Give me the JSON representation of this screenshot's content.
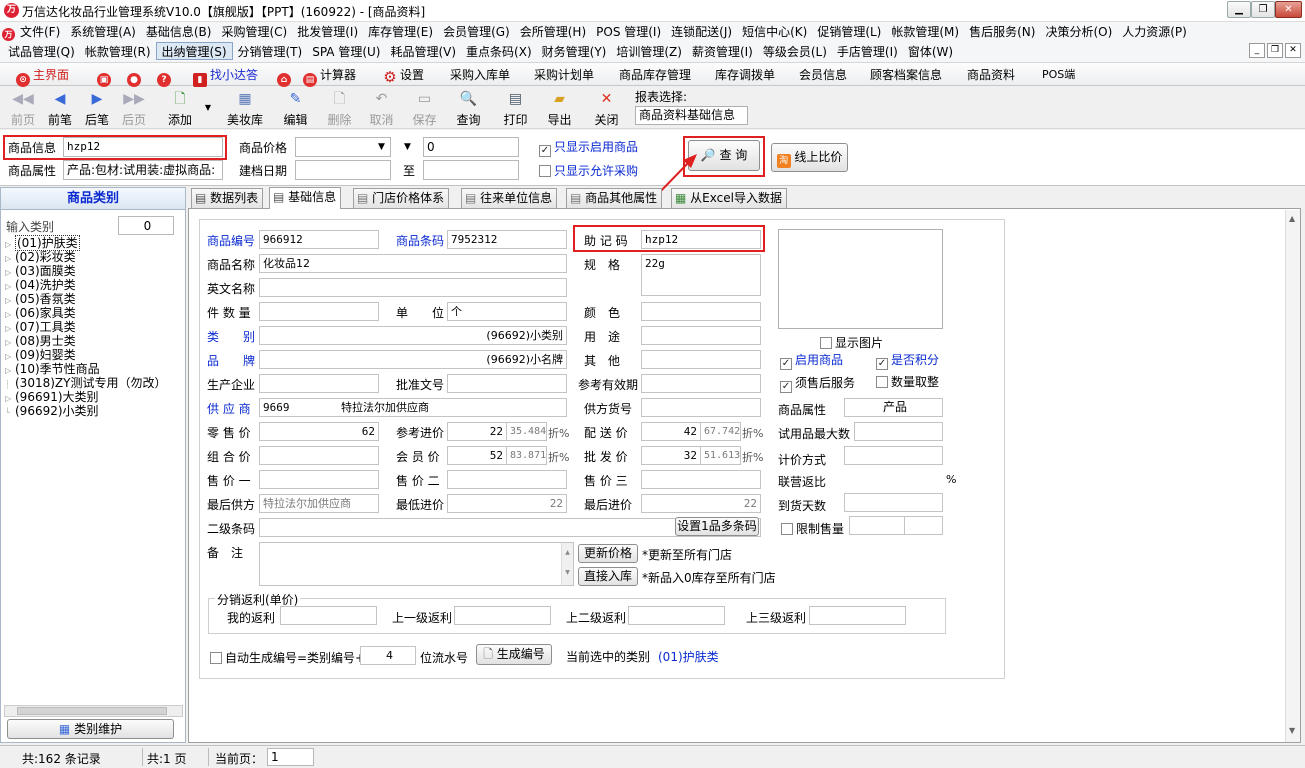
{
  "window": {
    "title": "万信达化妆品行业管理系统V10.0【旗舰版】【PPT】(160922) - [商品资料]",
    "min": "▁",
    "restore": "❐",
    "close": "✕"
  },
  "menu": {
    "row1": [
      "文件(F)",
      "系统管理(A)",
      "基础信息(B)",
      "采购管理(C)",
      "批发管理(I)",
      "库存管理(E)",
      "会员管理(G)",
      "会所管理(H)",
      "POS 管理(I)",
      "连锁配送(J)",
      "短信中心(K)",
      "促销管理(L)",
      "帐款管理(M)",
      "售后服务(N)",
      "决策分析(O)",
      "人力资源(P)"
    ],
    "row2": [
      "试品管理(Q)",
      "帐款管理(R)",
      "出纳管理(S)",
      "分销管理(T)",
      "SPA 管理(U)",
      "耗品管理(V)",
      "重点条码(X)",
      "财务管理(Y)",
      "培训管理(Z)",
      "薪资管理(I)",
      "等级会员(L)",
      "手店管理(I)",
      "窗体(W)"
    ],
    "mdi": [
      "_",
      "❐",
      "✕"
    ]
  },
  "quickbar": {
    "items": [
      "主界面",
      "找小达答",
      "计算器",
      "设置",
      "采购入库单",
      "采购计划单",
      "商品库存管理",
      "库存调拨单",
      "会员信息",
      "顾客档案信息",
      "商品资料",
      "POS端"
    ]
  },
  "toolbar": {
    "buttons": [
      "前页",
      "前笔",
      "后笔",
      "后页",
      "添加",
      "美妆库",
      "编辑",
      "删除",
      "取消",
      "保存",
      "查询",
      "打印",
      "导出",
      "关闭"
    ],
    "report_label": "报表选择:",
    "report_value": "商品资料基础信息"
  },
  "search": {
    "info_label": "商品信息",
    "info_value": "hzp12",
    "attr_label": "商品属性",
    "attr_value": "产品:包材:试用装:虚拟商品:",
    "price_label": "商品价格",
    "price_value": "",
    "price_to": "0",
    "date_label": "建档日期",
    "date_to": "至",
    "only_enabled": "只显示启用商品",
    "only_purchase": "只显示允许采购",
    "query_btn": "查 询",
    "compare_btn": "线上比价"
  },
  "sidebar": {
    "title": "商品类别",
    "input_label": "输入类别",
    "input_value": "0",
    "tree": [
      "(01)护肤类",
      "(02)彩妆类",
      "(03)面膜类",
      "(04)洗护类",
      "(05)香氛类",
      "(06)家具类",
      "(07)工具类",
      "(08)男士类",
      "(09)妇婴类",
      "(10)季节性商品",
      "(3018)ZY测试专用（勿改）",
      "(96691)大类别",
      "(96692)小类别"
    ],
    "maint_btn": "类别维护"
  },
  "tabs": [
    "数据列表",
    "基础信息",
    "门店价格体系",
    "往来单位信息",
    "商品其他属性",
    "从Excel导入数据"
  ],
  "form": {
    "code_label": "商品编号",
    "code": "966912",
    "barcode_label": "商品条码",
    "barcode": "7952312",
    "mnemonic_label": "助 记 码",
    "mnemonic": "hzp12",
    "name_label": "商品名称",
    "name": "化妆品12",
    "spec_label": "规　格",
    "spec": "22g",
    "en_label": "英文名称",
    "qty_label": "件 数 量",
    "unit_label": "单　　位",
    "unit": "个",
    "color_label": "颜　色",
    "cat_label": "类　　别",
    "cat": "(96692)小类别",
    "use_label": "用　途",
    "brand_label": "品　　牌",
    "brand": "(96692)小名牌",
    "other_label": "其　他",
    "maker_label": "生产企业",
    "approval_label": "批准文号",
    "expiry_label": "参考有效期",
    "supplier_label": "供 应 商",
    "supplier_code": "9669",
    "supplier_name": "特拉法尔加供应商",
    "sup_no_label": "供方货号",
    "retail_label": "零 售 价",
    "retail": "62",
    "refin_label": "参考进价",
    "refin": "22",
    "refin_pct": "35.484",
    "dist_label": "配 送 价",
    "dist": "42",
    "dist_pct": "67.742",
    "combo_label": "组 合 价",
    "member_label": "会 员 价",
    "member": "52",
    "member_pct": "83.871",
    "whole_label": "批 发 价",
    "whole": "32",
    "whole_pct": "51.613",
    "discount": "折%",
    "p1_label": "售 价 一",
    "p2_label": "售 价 二",
    "p3_label": "售 价 三",
    "lastsup_label": "最后供方",
    "lastsup": "特拉法尔加供应商",
    "minin_label": "最低进价",
    "minin": "22",
    "lastin_label": "最后进价",
    "lastin": "22",
    "barcode2_label": "二级条码",
    "multi_btn": "设置1品多条码",
    "note_label": "备　注",
    "update_btn": "更新价格",
    "update_note": "*更新至所有门店",
    "stock_btn": "直接入库",
    "stock_note": "*新品入0库存至所有门店",
    "rebate_legend": "分销返利(单价)",
    "my_rebate": "我的返利",
    "up1": "上一级返利",
    "up2": "上二级返利",
    "up3": "上三级返利",
    "auto_label": "自动生成编号=类别编号+",
    "auto_digits": "4",
    "serial_label": "位流水号",
    "gen_btn": "生成编号",
    "current_cat_label": "当前选中的类别",
    "current_cat": "(01)护肤类",
    "show_img": "显示图片",
    "enabled": "启用商品",
    "points": "是否积分",
    "after_sale": "须售后服务",
    "qty_round": "数量取整",
    "prop_label": "商品属性",
    "prop": "产品",
    "trial_max": "试用品最大数",
    "pricing": "计价方式",
    "joint": "联营返比",
    "joint_pct": "%",
    "arrival": "到货天数",
    "limit": "限制售量"
  },
  "status": {
    "records": "共:162 条记录",
    "pages": "共:1 页",
    "current_label": "当前页：",
    "current": "1"
  }
}
